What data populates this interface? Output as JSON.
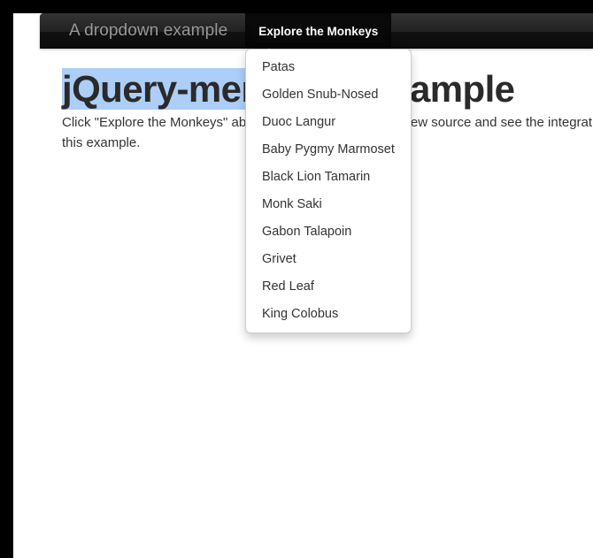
{
  "navbar": {
    "brand_label": "A dropdown example",
    "items": [
      {
        "label": "Explore the Monkeys",
        "active": true,
        "has_caret": true
      }
    ]
  },
  "dropdown": {
    "open": true,
    "items": [
      {
        "label": "Patas"
      },
      {
        "label": "Golden Snub-Nosed"
      },
      {
        "label": "Duoc Langur"
      },
      {
        "label": "Baby Pygmy Marmoset"
      },
      {
        "label": "Black Lion Tamarin"
      },
      {
        "label": "Monk Saki"
      },
      {
        "label": "Gabon Talapoin"
      },
      {
        "label": "Grivet"
      },
      {
        "label": "Red Leaf"
      },
      {
        "label": "King Colobus"
      }
    ]
  },
  "content": {
    "title_selected": "jQuery-menu-aim e",
    "title_rest": "xample",
    "lead_text": "Click \"Explore the Monkeys\" above to see the dropdown. View source and see the integration points for this example."
  },
  "colors": {
    "navbar_background": "#222222",
    "navbar_active_background": "#0b0b0b",
    "brand_text": "#999999",
    "nav_link_text": "#ffffff",
    "dropdown_background": "#ffffff",
    "dropdown_border": "#cccccc",
    "menu_text": "#333333",
    "title_text": "#2a2a2a",
    "selection_highlight": "#accef7",
    "body_text": "#333333",
    "frame": "#000000"
  }
}
